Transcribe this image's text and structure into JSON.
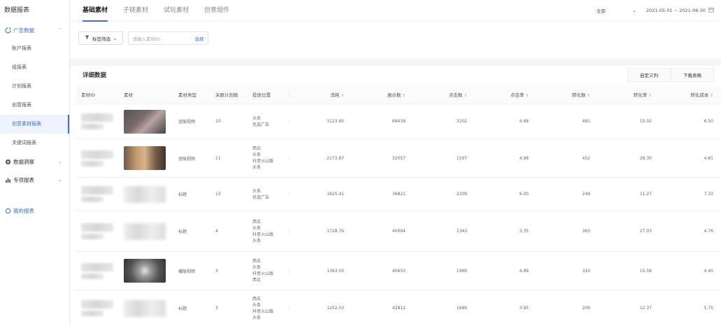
{
  "sidebar": {
    "brand": "数据报表",
    "groups": [
      {
        "label": "广告数据",
        "items": [
          "账户报表",
          "组报表",
          "计划报表",
          "创意报表",
          "创意素材报表",
          "关键词报表"
        ]
      },
      {
        "label": "数据洞察"
      },
      {
        "label": "专项报表"
      },
      {
        "label": "我的报表"
      }
    ],
    "active_item": "创意素材报表"
  },
  "tabs": [
    "基础素材",
    "子链素材",
    "试玩素材",
    "创意组件"
  ],
  "active_tab": "基础素材",
  "topbar": {
    "select_value": "全部",
    "date_range": "2021-05-01 ~ 2021-06-30"
  },
  "filter": {
    "button_label": "标签筛选",
    "search_placeholder": "请输入素材ID",
    "search_link": "选择"
  },
  "panel": {
    "title": "详细数据",
    "action_custom": "自定义列",
    "action_download": "下载表格"
  },
  "table": {
    "columns": [
      "素材ID",
      "素材",
      "素材类型",
      "关联计划数",
      "投放位置",
      "消耗",
      "展示数",
      "点击数",
      "点击率",
      "转化数",
      "转化率",
      "转化成本"
    ],
    "rows": [
      {
        "type": "竖版视频",
        "plans": "10",
        "placements": [
          "头条",
          "优选广告"
        ],
        "cost": "3123.85",
        "impressions": "68439",
        "clicks": "3202",
        "ctr": "4.68",
        "conversions": "481",
        "cvr": "15.02",
        "cpa": "6.50",
        "thumb": "photo1"
      },
      {
        "type": "竖版视频",
        "plans": "11",
        "placements": [
          "西瓜",
          "头条",
          "抖音火山版",
          "头条"
        ],
        "cost": "2173.87",
        "impressions": "32057",
        "clicks": "1597",
        "ctr": "4.98",
        "conversions": "452",
        "cvr": "28.30",
        "cpa": "4.81",
        "thumb": "photo2"
      },
      {
        "type": "标题",
        "plans": "13",
        "placements": [
          "头条",
          "优选广告"
        ],
        "cost": "1825.41",
        "impressions": "36821",
        "clicks": "2209",
        "ctr": "6.00",
        "conversions": "249",
        "cvr": "11.27",
        "cpa": "7.33",
        "thumb": "blurred"
      },
      {
        "type": "标题",
        "plans": "4",
        "placements": [
          "西瓜",
          "头条",
          "抖音火山版",
          "头条"
        ],
        "cost": "1728.76",
        "impressions": "40064",
        "clicks": "1343",
        "ctr": "3.35",
        "conversions": "363",
        "cvr": "27.03",
        "cpa": "4.76",
        "thumb": "blurred"
      },
      {
        "type": "横版视频",
        "plans": "3",
        "placements": [
          "西瓜",
          "头条",
          "抖音火山版",
          "西瓜"
        ],
        "cost": "1363.03",
        "impressions": "40653",
        "clicks": "1989",
        "ctr": "4.89",
        "conversions": "310",
        "cvr": "15.59",
        "cpa": "4.40",
        "thumb": "photo3"
      },
      {
        "type": "标题",
        "plans": "3",
        "placements": [
          "西瓜",
          "头条",
          "抖音火山版",
          "头条"
        ],
        "cost": "1202.03",
        "impressions": "42812",
        "clicks": "1689",
        "ctr": "3.95",
        "conversions": "209",
        "cvr": "12.37",
        "cpa": "5.75",
        "thumb": "blurred"
      }
    ]
  }
}
